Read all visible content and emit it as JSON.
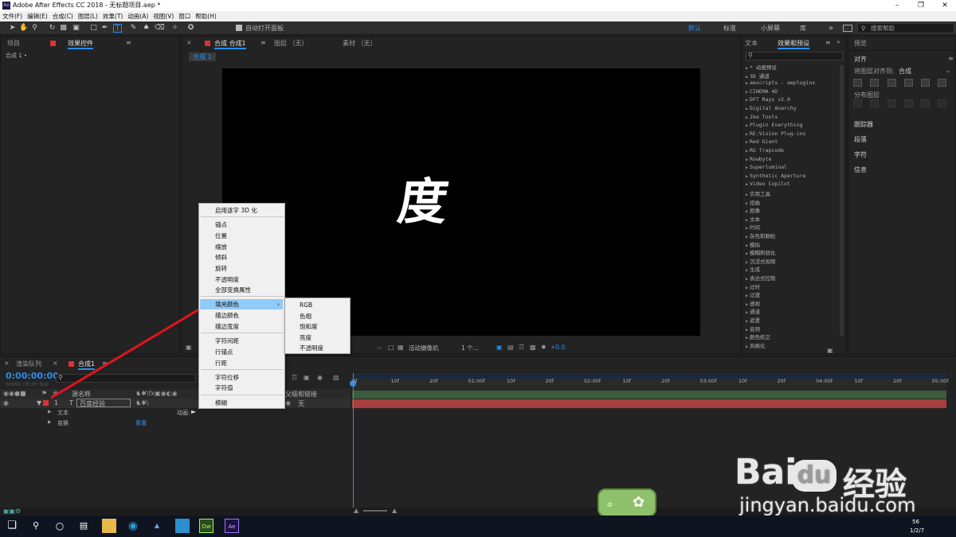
{
  "window": {
    "app_title": "Adobe After Effects CC 2018 - 无标题项目.aep *",
    "app_icon": "Ae"
  },
  "menu": [
    "文件(F)",
    "编辑(E)",
    "合成(C)",
    "图层(L)",
    "效果(T)",
    "动画(A)",
    "视图(V)",
    "窗口",
    "帮助(H)"
  ],
  "toolbar": {
    "auto_open_label": "自动打开面板",
    "workspaces": [
      "默认",
      "标准",
      "小屏幕",
      "库"
    ],
    "search_placeholder": "搜索帮助"
  },
  "project_panel": {
    "tab1": "项目",
    "tab2": "效果控件",
    "sub": "合成 1 •"
  },
  "comp_panel": {
    "tab_comp": "合成 合成1",
    "tab_layer": "图层 （无）",
    "tab_footage": "素材 （无）",
    "sub_tab": "合成 1",
    "canvas_text": "度",
    "footer": {
      "view": "活动摄像机",
      "count": "1 个...",
      "offset": "+0.0"
    }
  },
  "effects_panel": {
    "tab1": "文本",
    "tab2": "效果和预设",
    "items": [
      "* 动画预设",
      "3D 通道",
      "aescripts - aeplugins",
      "CINEMA 4D",
      "DFT Rays v2.0",
      "Digital Anarchy",
      "Jke Tools",
      "Plugin Everything",
      "RE:Vision Plug-ins",
      "Red Giant",
      "RG Trapcode",
      "Rowbyte",
      "Superluminal",
      "Synthetic Aperture",
      "Video Copilot",
      "实用工具",
      "扭曲",
      "抠像",
      "文本",
      "时间",
      "杂色和颗粒",
      "模拟",
      "模糊和锐化",
      "沉浸式视频",
      "生成",
      "表达式控制",
      "过时",
      "过渡",
      "透视",
      "通道",
      "遮罩",
      "音频",
      "颜色校正",
      "风格化"
    ]
  },
  "right_panel": {
    "preview": "预览",
    "align": "对齐",
    "align_to_label": "将图层对齐到:",
    "align_to_value": "合成",
    "distribute": "分布图层",
    "sections": [
      "跟踪器",
      "段落",
      "字符",
      "信息"
    ]
  },
  "context_menu": {
    "items": [
      "启用逐字 3D 化",
      "锚点",
      "位置",
      "缩放",
      "倾斜",
      "旋转",
      "不透明度",
      "全部变换属性",
      "填充颜色",
      "描边颜色",
      "描边宽度",
      "字符间距",
      "行锚点",
      "行距",
      "字符位移",
      "字符值",
      "模糊"
    ],
    "highlighted": "填充颜色",
    "submenu": [
      "RGB",
      "色相",
      "饱和度",
      "亮度",
      "不透明度"
    ]
  },
  "timeline": {
    "tab_render": "渲染队列",
    "tab_comp": "合成1",
    "timecode": "0:00:00:00",
    "fps": "00000 (30.00 fps)",
    "col_source": "源名称",
    "col_parent": "父级和链接",
    "layer_num": "1",
    "layer_name": "百度经验",
    "parent_value": "无",
    "sub_text": "文本",
    "sub_transform": "变换",
    "animate": "动画:",
    "reset": "重置",
    "ticks": [
      "0f",
      "10f",
      "20f",
      "01:00f",
      "10f",
      "20f",
      "02:00f",
      "10f",
      "20f",
      "03:00f",
      "10f",
      "20f",
      "04:00f",
      "10f",
      "20f",
      "05:00f"
    ]
  },
  "watermark": {
    "brand": "Bai",
    "paw": "du",
    "cn": "经验",
    "url": "jingyan.baidu.com",
    "badge": "中"
  },
  "taskbar": {
    "time": "56",
    "date": "1/2/7",
    "apps": [
      "Dw",
      "Ae"
    ]
  }
}
